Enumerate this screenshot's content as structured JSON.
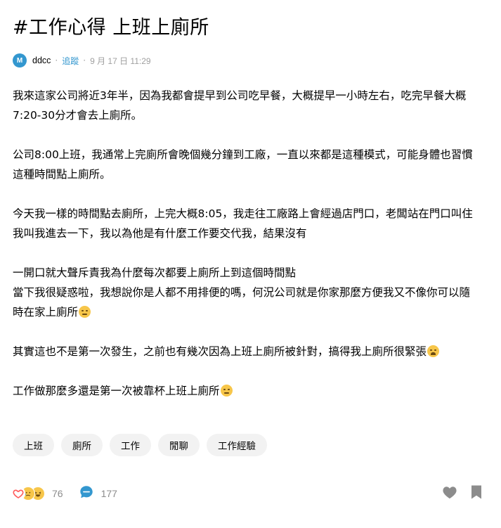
{
  "post": {
    "title": "#工作心得 上班上廁所",
    "author_initial": "M",
    "author": "ddcc",
    "separator": "·",
    "follow_label": "追蹤",
    "date": "9 月 17 日 11:29",
    "paragraphs": [
      {
        "text": "我來這家公司將近3年半，因為我都會提早到公司吃早餐，大概提早一小時左右，吃完早餐大概\n7:20-30分才會去上廁所。"
      },
      {
        "text": "公司8:00上班，我通常上完廁所會晚個幾分鐘到工廠，一直以來都是這種模式，可能身體也習慣\n這種時間點上廁所。"
      },
      {
        "text": "今天我一樣的時間點去廁所，上完大概8:05，我走往工廠路上會經過店門口，老闆站在門口叫住\n我叫我進去一下，我以為他是有什麼工作要交代我，結果沒有"
      },
      {
        "text": "一開口就大聲斥責我為什麼每次都要上廁所上到這個時間點\n當下我很疑惑啦，我想說你是人都不用排便的嗎，何況公司就是你家那麼方便我又不像你可以隨\n時在家上廁所",
        "emoji": "unamused-face"
      },
      {
        "text": "其實這也不是第一次發生，之前也有幾次因為上班上廁所被針對，搞得我上廁所很緊張",
        "emoji": "tired-face"
      },
      {
        "text": "工作做那麼多還是第一次被靠杯上班上廁所",
        "emoji": "unamused-face"
      }
    ],
    "tags": [
      "上班",
      "廁所",
      "工作",
      "閒聊",
      "工作經驗"
    ]
  },
  "footer": {
    "reaction_icons": [
      "heart-icon",
      "crying-face-icon",
      "laughing-face-icon"
    ],
    "reaction_count": "76",
    "comment_count": "177"
  },
  "colors": {
    "accent": "#3397cf",
    "muted": "#a0a0a0",
    "tag_bg": "#f2f2f2",
    "heart": "#ff5a5a",
    "emoji_yellow": "#f7c64a",
    "icon_grey": "#8c8c8c"
  }
}
